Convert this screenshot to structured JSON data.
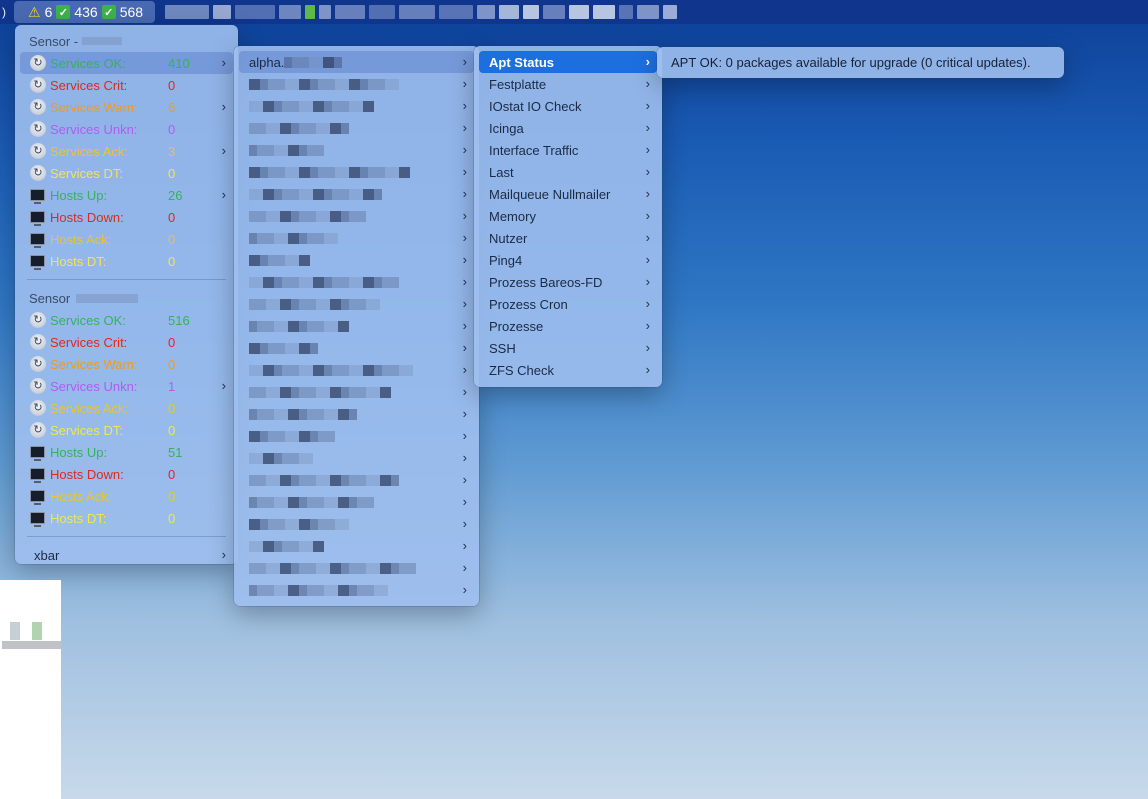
{
  "menubar": {
    "edge_char": ")",
    "status_warn_icon": "⚠",
    "warn_count": "6",
    "ok_icon": "✓",
    "ok_count_1": "436",
    "ok_count_2": "568"
  },
  "sensor_menu": {
    "sensor1_header": "Sensor -",
    "sensor2_header": "Sensor",
    "sensor1_rows": [
      {
        "label": "Services OK:",
        "value": "410",
        "color": "#35b35a",
        "icon": "service-icon",
        "submenu": true
      },
      {
        "label": "Services Crit:",
        "value": "0",
        "color": "#e0281e",
        "icon": "service-icon",
        "submenu": false
      },
      {
        "label": "Services Warn:",
        "value": "6",
        "color": "#f29a1c",
        "icon": "service-icon",
        "submenu": true
      },
      {
        "label": "Services Unkn:",
        "value": "0",
        "color": "#b35af2",
        "icon": "service-icon",
        "submenu": false
      },
      {
        "label": "Services Ack:",
        "value": "3",
        "color": "#f0c328",
        "icon": "service-icon",
        "submenu": true
      },
      {
        "label": "Services DT:",
        "value": "0",
        "color": "#f3e64a",
        "icon": "service-icon",
        "submenu": false
      },
      {
        "label": "Hosts Up:",
        "value": "26",
        "color": "#35b35a",
        "icon": "host-icon",
        "submenu": true
      },
      {
        "label": "Hosts Down:",
        "value": "0",
        "color": "#e0281e",
        "icon": "host-icon",
        "submenu": false
      },
      {
        "label": "Hosts Ack:",
        "value": "0",
        "color": "#f0c328",
        "icon": "host-icon",
        "submenu": false
      },
      {
        "label": "Hosts DT:",
        "value": "0",
        "color": "#f3e64a",
        "icon": "host-icon",
        "submenu": false
      }
    ],
    "sensor2_rows": [
      {
        "label": "Services OK:",
        "value": "516",
        "color": "#35b35a",
        "icon": "service-icon",
        "submenu": false
      },
      {
        "label": "Services Crit:",
        "value": "0",
        "color": "#e0281e",
        "icon": "service-icon",
        "submenu": false
      },
      {
        "label": "Services Warn:",
        "value": "0",
        "color": "#f29a1c",
        "icon": "service-icon",
        "submenu": false
      },
      {
        "label": "Services Unkn:",
        "value": "1",
        "color": "#b35af2",
        "icon": "service-icon",
        "submenu": true
      },
      {
        "label": "Services Ack:",
        "value": "0",
        "color": "#f0c328",
        "icon": "service-icon",
        "submenu": false
      },
      {
        "label": "Services DT:",
        "value": "0",
        "color": "#f3e64a",
        "icon": "service-icon",
        "submenu": false
      },
      {
        "label": "Hosts Up:",
        "value": "51",
        "color": "#35b35a",
        "icon": "host-icon",
        "submenu": false
      },
      {
        "label": "Hosts Down:",
        "value": "0",
        "color": "#e0281e",
        "icon": "host-icon",
        "submenu": false
      },
      {
        "label": "Hosts Ack:",
        "value": "0",
        "color": "#f0c328",
        "icon": "host-icon",
        "submenu": false
      },
      {
        "label": "Hosts DT:",
        "value": "0",
        "color": "#f3e64a",
        "icon": "host-icon",
        "submenu": false
      }
    ],
    "xbar_label": "xbar"
  },
  "hosts_menu": {
    "first_host_label": "alpha.",
    "chevron": "›"
  },
  "checks_menu": {
    "items": [
      "Apt Status",
      "Festplatte",
      "IOstat IO Check",
      "Icinga",
      "Interface Traffic",
      "Last",
      "Mailqueue Nullmailer",
      "Memory",
      "Nutzer",
      "Ping4",
      "Prozess Bareos-FD",
      "Prozess Cron",
      "Prozesse",
      "SSH",
      "ZFS Check"
    ],
    "selected_index": 0
  },
  "tooltip": {
    "text": "APT OK: 0 packages available for upgrade (0 critical updates)."
  }
}
